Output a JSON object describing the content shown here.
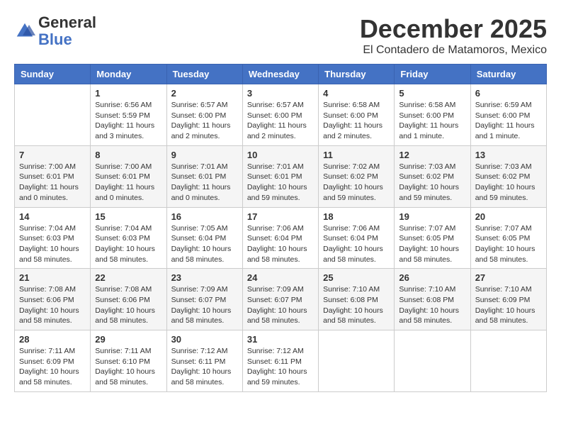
{
  "header": {
    "logo_line1": "General",
    "logo_line2": "Blue",
    "month": "December 2025",
    "location": "El Contadero de Matamoros, Mexico"
  },
  "days_of_week": [
    "Sunday",
    "Monday",
    "Tuesday",
    "Wednesday",
    "Thursday",
    "Friday",
    "Saturday"
  ],
  "weeks": [
    [
      {
        "day": "",
        "sunrise": "",
        "sunset": "",
        "daylight": ""
      },
      {
        "day": "1",
        "sunrise": "Sunrise: 6:56 AM",
        "sunset": "Sunset: 5:59 PM",
        "daylight": "Daylight: 11 hours and 3 minutes."
      },
      {
        "day": "2",
        "sunrise": "Sunrise: 6:57 AM",
        "sunset": "Sunset: 6:00 PM",
        "daylight": "Daylight: 11 hours and 2 minutes."
      },
      {
        "day": "3",
        "sunrise": "Sunrise: 6:57 AM",
        "sunset": "Sunset: 6:00 PM",
        "daylight": "Daylight: 11 hours and 2 minutes."
      },
      {
        "day": "4",
        "sunrise": "Sunrise: 6:58 AM",
        "sunset": "Sunset: 6:00 PM",
        "daylight": "Daylight: 11 hours and 2 minutes."
      },
      {
        "day": "5",
        "sunrise": "Sunrise: 6:58 AM",
        "sunset": "Sunset: 6:00 PM",
        "daylight": "Daylight: 11 hours and 1 minute."
      },
      {
        "day": "6",
        "sunrise": "Sunrise: 6:59 AM",
        "sunset": "Sunset: 6:00 PM",
        "daylight": "Daylight: 11 hours and 1 minute."
      }
    ],
    [
      {
        "day": "7",
        "sunrise": "Sunrise: 7:00 AM",
        "sunset": "Sunset: 6:01 PM",
        "daylight": "Daylight: 11 hours and 0 minutes."
      },
      {
        "day": "8",
        "sunrise": "Sunrise: 7:00 AM",
        "sunset": "Sunset: 6:01 PM",
        "daylight": "Daylight: 11 hours and 0 minutes."
      },
      {
        "day": "9",
        "sunrise": "Sunrise: 7:01 AM",
        "sunset": "Sunset: 6:01 PM",
        "daylight": "Daylight: 11 hours and 0 minutes."
      },
      {
        "day": "10",
        "sunrise": "Sunrise: 7:01 AM",
        "sunset": "Sunset: 6:01 PM",
        "daylight": "Daylight: 10 hours and 59 minutes."
      },
      {
        "day": "11",
        "sunrise": "Sunrise: 7:02 AM",
        "sunset": "Sunset: 6:02 PM",
        "daylight": "Daylight: 10 hours and 59 minutes."
      },
      {
        "day": "12",
        "sunrise": "Sunrise: 7:03 AM",
        "sunset": "Sunset: 6:02 PM",
        "daylight": "Daylight: 10 hours and 59 minutes."
      },
      {
        "day": "13",
        "sunrise": "Sunrise: 7:03 AM",
        "sunset": "Sunset: 6:02 PM",
        "daylight": "Daylight: 10 hours and 59 minutes."
      }
    ],
    [
      {
        "day": "14",
        "sunrise": "Sunrise: 7:04 AM",
        "sunset": "Sunset: 6:03 PM",
        "daylight": "Daylight: 10 hours and 58 minutes."
      },
      {
        "day": "15",
        "sunrise": "Sunrise: 7:04 AM",
        "sunset": "Sunset: 6:03 PM",
        "daylight": "Daylight: 10 hours and 58 minutes."
      },
      {
        "day": "16",
        "sunrise": "Sunrise: 7:05 AM",
        "sunset": "Sunset: 6:04 PM",
        "daylight": "Daylight: 10 hours and 58 minutes."
      },
      {
        "day": "17",
        "sunrise": "Sunrise: 7:06 AM",
        "sunset": "Sunset: 6:04 PM",
        "daylight": "Daylight: 10 hours and 58 minutes."
      },
      {
        "day": "18",
        "sunrise": "Sunrise: 7:06 AM",
        "sunset": "Sunset: 6:04 PM",
        "daylight": "Daylight: 10 hours and 58 minutes."
      },
      {
        "day": "19",
        "sunrise": "Sunrise: 7:07 AM",
        "sunset": "Sunset: 6:05 PM",
        "daylight": "Daylight: 10 hours and 58 minutes."
      },
      {
        "day": "20",
        "sunrise": "Sunrise: 7:07 AM",
        "sunset": "Sunset: 6:05 PM",
        "daylight": "Daylight: 10 hours and 58 minutes."
      }
    ],
    [
      {
        "day": "21",
        "sunrise": "Sunrise: 7:08 AM",
        "sunset": "Sunset: 6:06 PM",
        "daylight": "Daylight: 10 hours and 58 minutes."
      },
      {
        "day": "22",
        "sunrise": "Sunrise: 7:08 AM",
        "sunset": "Sunset: 6:06 PM",
        "daylight": "Daylight: 10 hours and 58 minutes."
      },
      {
        "day": "23",
        "sunrise": "Sunrise: 7:09 AM",
        "sunset": "Sunset: 6:07 PM",
        "daylight": "Daylight: 10 hours and 58 minutes."
      },
      {
        "day": "24",
        "sunrise": "Sunrise: 7:09 AM",
        "sunset": "Sunset: 6:07 PM",
        "daylight": "Daylight: 10 hours and 58 minutes."
      },
      {
        "day": "25",
        "sunrise": "Sunrise: 7:10 AM",
        "sunset": "Sunset: 6:08 PM",
        "daylight": "Daylight: 10 hours and 58 minutes."
      },
      {
        "day": "26",
        "sunrise": "Sunrise: 7:10 AM",
        "sunset": "Sunset: 6:08 PM",
        "daylight": "Daylight: 10 hours and 58 minutes."
      },
      {
        "day": "27",
        "sunrise": "Sunrise: 7:10 AM",
        "sunset": "Sunset: 6:09 PM",
        "daylight": "Daylight: 10 hours and 58 minutes."
      }
    ],
    [
      {
        "day": "28",
        "sunrise": "Sunrise: 7:11 AM",
        "sunset": "Sunset: 6:09 PM",
        "daylight": "Daylight: 10 hours and 58 minutes."
      },
      {
        "day": "29",
        "sunrise": "Sunrise: 7:11 AM",
        "sunset": "Sunset: 6:10 PM",
        "daylight": "Daylight: 10 hours and 58 minutes."
      },
      {
        "day": "30",
        "sunrise": "Sunrise: 7:12 AM",
        "sunset": "Sunset: 6:11 PM",
        "daylight": "Daylight: 10 hours and 58 minutes."
      },
      {
        "day": "31",
        "sunrise": "Sunrise: 7:12 AM",
        "sunset": "Sunset: 6:11 PM",
        "daylight": "Daylight: 10 hours and 59 minutes."
      },
      {
        "day": "",
        "sunrise": "",
        "sunset": "",
        "daylight": ""
      },
      {
        "day": "",
        "sunrise": "",
        "sunset": "",
        "daylight": ""
      },
      {
        "day": "",
        "sunrise": "",
        "sunset": "",
        "daylight": ""
      }
    ]
  ]
}
